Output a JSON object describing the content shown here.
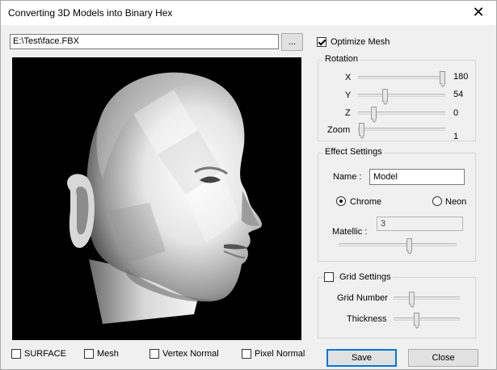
{
  "window": {
    "title": "Converting 3D Models into Binary Hex",
    "close_glyph": "✕"
  },
  "file": {
    "path": "E:\\Test\\face.FBX",
    "browse_label": "..."
  },
  "optimize_mesh": {
    "label": "Optimize Mesh",
    "checked": true
  },
  "rotation": {
    "title": "Rotation",
    "sliders": [
      {
        "label": "X",
        "value": "180",
        "fraction": 1.0
      },
      {
        "label": "Y",
        "value": "54",
        "fraction": 0.3
      },
      {
        "label": "Z",
        "value": "0",
        "fraction": 0.15
      },
      {
        "label": "Zoom",
        "value": "1",
        "fraction": 0.0
      }
    ]
  },
  "effect_settings": {
    "title": "Effect Settings",
    "name_label": "Name :",
    "name_value": "Model",
    "radio_chrome": "Chrome",
    "radio_neon": "Neon",
    "selected": "Chrome",
    "metallic_label": "Matellic :",
    "metallic_value": "3",
    "metallic_fraction": 0.6
  },
  "grid_settings": {
    "title": "Grid Settings",
    "checked": false,
    "grid_number_label": "Grid Number",
    "grid_number_fraction": 0.3,
    "thickness_label": "Thickness",
    "thickness_fraction": 0.38
  },
  "bottom_checkboxes": [
    {
      "label": "SURFACE",
      "checked": false
    },
    {
      "label": "Mesh",
      "checked": false
    },
    {
      "label": "Vertex Normal",
      "checked": false
    },
    {
      "label": "Pixel Normal",
      "checked": false
    }
  ],
  "buttons": {
    "save": "Save",
    "close": "Close"
  }
}
